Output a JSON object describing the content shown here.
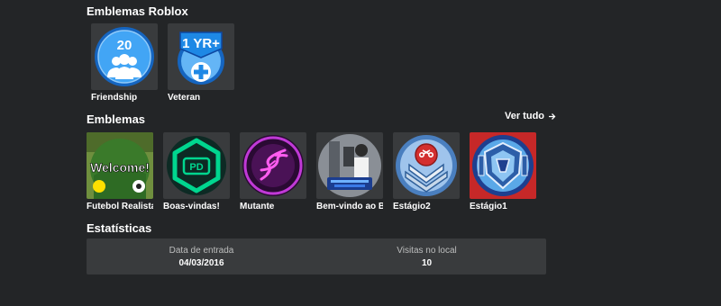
{
  "roblox_badges": {
    "title": "Emblemas Roblox",
    "items": [
      {
        "name": "Friendship",
        "count": "20"
      },
      {
        "name": "Veteran",
        "tag": "1 YR+"
      }
    ]
  },
  "badges": {
    "title": "Emblemas",
    "see_all": "Ver tudo",
    "items": [
      {
        "name": "Futebol Realista -…",
        "thumb_text": "Welcome!"
      },
      {
        "name": "Boas-vindas!",
        "thumb_text": "PD"
      },
      {
        "name": "Mutante"
      },
      {
        "name": "Bem-vindo ao Br…"
      },
      {
        "name": "Estágio2"
      },
      {
        "name": "Estágio1"
      }
    ]
  },
  "stats": {
    "title": "Estatísticas",
    "items": [
      {
        "label": "Data de entrada",
        "value": "04/03/2016"
      },
      {
        "label": "Visitas no local",
        "value": "10"
      }
    ]
  },
  "colors": {
    "background": "#232527",
    "card": "#393b3d",
    "roblox_blue": "#1e88e5",
    "pd_green": "#00d68f"
  }
}
